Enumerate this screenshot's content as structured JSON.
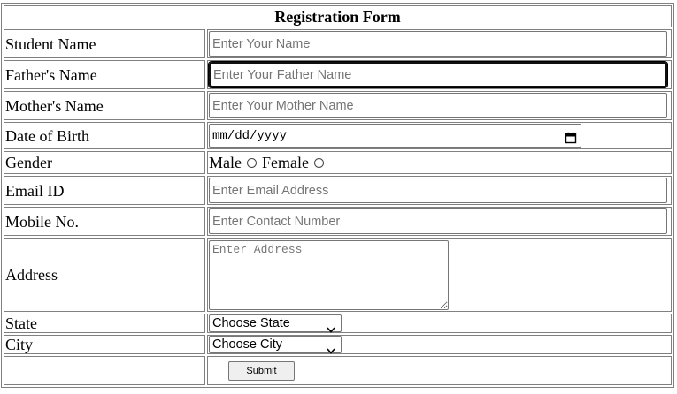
{
  "form": {
    "title": "Registration Form",
    "student_name": {
      "label": "Student Name",
      "placeholder": "Enter Your Name"
    },
    "father_name": {
      "label": "Father's Name",
      "placeholder": "Enter Your Father Name"
    },
    "mother_name": {
      "label": "Mother's Name",
      "placeholder": "Enter Your Mother Name"
    },
    "dob": {
      "label": "Date of Birth",
      "placeholder": "mm/dd/yyyy",
      "icon": "calendar-icon"
    },
    "gender": {
      "label": "Gender",
      "options": [
        "Male",
        "Female"
      ]
    },
    "email": {
      "label": "Email ID",
      "placeholder": "Enter Email Address"
    },
    "mobile": {
      "label": "Mobile No.",
      "placeholder": "Enter Contact Number"
    },
    "address": {
      "label": "Address",
      "placeholder": "Enter Address"
    },
    "state": {
      "label": "State",
      "selected": "Choose State",
      "icon": "chevron-down-icon"
    },
    "city": {
      "label": "City",
      "selected": "Choose City",
      "icon": "chevron-down-icon"
    },
    "submit_label": "Submit"
  }
}
